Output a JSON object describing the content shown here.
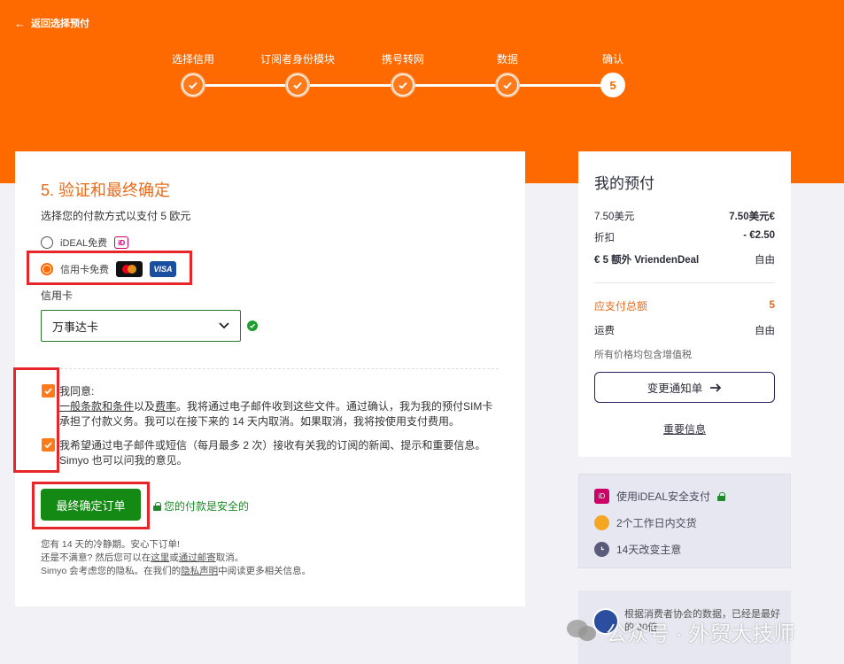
{
  "header": {
    "back_label": "返回选择预付"
  },
  "steps": [
    {
      "label": "选择信用",
      "state": "done"
    },
    {
      "label": "订阅者身份模块",
      "state": "done"
    },
    {
      "label": "携号转网",
      "state": "done"
    },
    {
      "label": "数据",
      "state": "done"
    },
    {
      "label": "确认",
      "state": "current",
      "number": "5"
    }
  ],
  "form": {
    "title": "5. 验证和最终确定",
    "subtitle": "选择您的付款方式以支付 5 欧元",
    "payment_options": [
      {
        "label": "iDEAL免费",
        "selected": false,
        "badge": "iD"
      },
      {
        "label": "信用卡免费",
        "selected": true,
        "cards": [
          "mastercard",
          "VISA"
        ]
      }
    ],
    "card_field_label": "信用卡",
    "card_select_value": "万事达卡",
    "agree_lead": "我同意:",
    "agree_link1": "一般条款和条件",
    "agree_mid": "以及",
    "agree_link2": "费率",
    "agree_rest": "。我将通过电子邮件收到这些文件。通过确认，我为我的预付SIM卡承担了付款义务。我可以在接下来的 14 天内取消。如果取消，我将按使用支付费用。",
    "newsletter_text": "我希望通过电子邮件或短信（每月最多 2 次）接收有关我的订阅的新闻、提示和重要信息。Simyo 也可以问我的意见。",
    "submit_label": "最终确定订单",
    "secure_label": "您的付款是安全的",
    "fine_line1": "您有 14 天的冷静期。安心下订单!",
    "fine_line2_a": "还是不满意? 然后您可以在",
    "fine_line2_link1": "这里",
    "fine_line2_b": "或",
    "fine_line2_link2": "通过邮寄",
    "fine_line2_c": "取消。",
    "fine_line3_a": "Simyo 会考虑您的隐私。在我们的",
    "fine_line3_link": "隐私声明",
    "fine_line3_b": "中阅读更多相关信息。"
  },
  "summary": {
    "title": "我的预付",
    "rows": [
      {
        "label": "7.50美元",
        "value": "7.50美元€"
      },
      {
        "label": "折扣",
        "value": "- €2.50"
      },
      {
        "label": "€ 5 额外 VriendenDeal",
        "value": "自由"
      }
    ],
    "total_label": "应支付总额",
    "total_value": "5",
    "shipping_label": "运费",
    "shipping_value": "自由",
    "vat_note": "所有价格均包含增值税",
    "notify_button": "变更通知单",
    "important_link": "重要信息"
  },
  "perks": [
    {
      "label": "使用iDEAL安全支付",
      "icon": "ideal-icon",
      "color": "#cc0066"
    },
    {
      "label": "2个工作日内交货",
      "icon": "postnl-icon",
      "color": "#f5a623"
    },
    {
      "label": "14天改变主意",
      "icon": "clock-icon",
      "color": "#5a5a7a"
    }
  ],
  "rating": {
    "text": "根据消费者协会的数据，已经是最好的 30倍"
  },
  "watermark": {
    "text": "公众号 · 外贸大技师"
  },
  "colors": {
    "brand_orange": "#ff6a00",
    "confirm_green": "#148a14",
    "highlight_red": "#e8262a"
  }
}
